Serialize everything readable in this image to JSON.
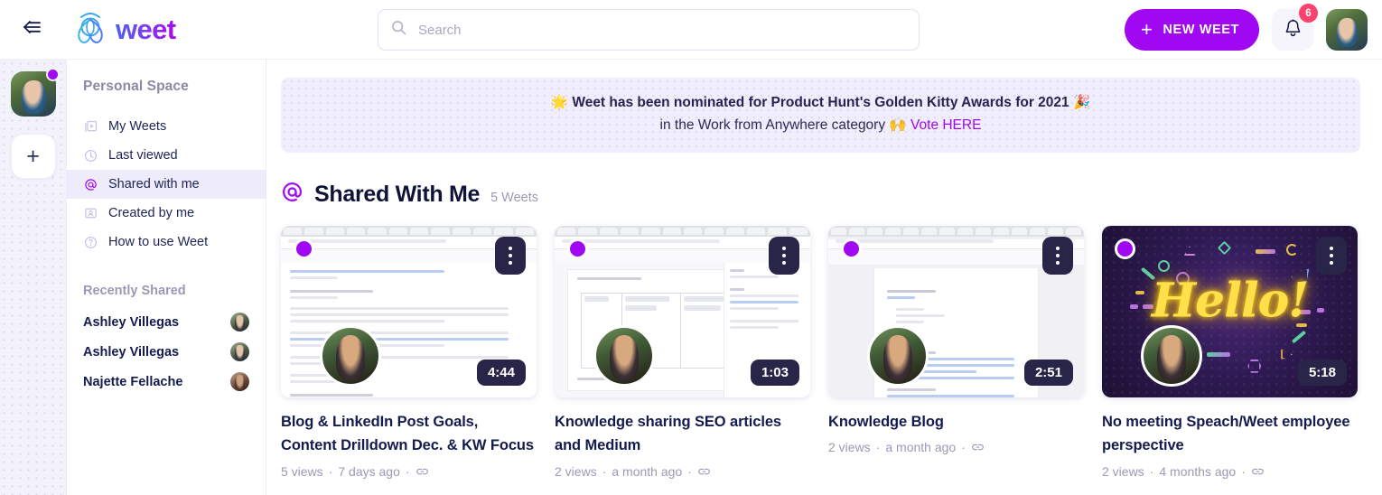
{
  "brand": {
    "name": "weet",
    "logo_icon": "weet-logo-icon",
    "collapse_icon": "collapse-sidebar-icon"
  },
  "header": {
    "search": {
      "placeholder": "Search",
      "value": "",
      "icon": "search-icon"
    },
    "new_weet_label": "NEW WEET",
    "new_weet_icon": "plus-icon",
    "notifications": {
      "icon": "bell-icon",
      "count": "6"
    },
    "avatar": "user-avatar"
  },
  "rail": {
    "workspace_avatar": "workspace-avatar",
    "status_dot": "online-status-dot",
    "add_label": "+",
    "add_icon": "plus-icon"
  },
  "sidebar": {
    "space_title": "Personal Space",
    "items": [
      {
        "label": "My Weets",
        "icon": "video-library-icon",
        "active": false
      },
      {
        "label": "Last viewed",
        "icon": "clock-icon",
        "active": false
      },
      {
        "label": "Shared with me",
        "icon": "at-sign-icon",
        "active": true
      },
      {
        "label": "Created by me",
        "icon": "id-card-icon",
        "active": false
      },
      {
        "label": "How to use Weet",
        "icon": "question-circle-icon",
        "active": false
      }
    ],
    "recently_shared_title": "Recently Shared",
    "recently_shared": [
      {
        "name": "Ashley Villegas",
        "avatar": "contact-avatar"
      },
      {
        "name": "Ashley Villegas",
        "avatar": "contact-avatar"
      },
      {
        "name": "Najette Fellache",
        "avatar": "contact-avatar"
      }
    ]
  },
  "banner": {
    "line1_emoji_left": "🌟",
    "line1": "Weet has been nominated for Product Hunt's Golden Kitty Awards for 2021",
    "line1_emoji_right": "🎉",
    "line2": "in the Work from Anywhere category",
    "line2_emoji": "🙌",
    "link": "Vote HERE",
    "link_color": "#9f08f0"
  },
  "section": {
    "icon": "at-sign-icon",
    "title": "Shared With Me",
    "count": "5 Weets"
  },
  "cards": [
    {
      "title": "Blog & LinkedIn Post Goals, Content Drilldown Dec. & KW Focus",
      "views": "5 views",
      "time": "7 days ago",
      "duration": "4:44",
      "thumb_kind": "gmail-thread",
      "link_icon": "link-icon",
      "menu_icon": "kebab-menu-icon"
    },
    {
      "title": "Knowledge sharing SEO articles and Medium",
      "views": "2 views",
      "time": "a month ago",
      "duration": "1:03",
      "thumb_kind": "google-doc-table",
      "link_icon": "link-icon",
      "menu_icon": "kebab-menu-icon"
    },
    {
      "title": "Knowledge Blog",
      "views": "2 views",
      "time": "a month ago",
      "duration": "2:51",
      "thumb_kind": "google-doc-links",
      "link_icon": "link-icon",
      "menu_icon": "kebab-menu-icon"
    },
    {
      "title": "No meeting Speach/Weet employee perspective",
      "views": "2 views",
      "time": "4 months ago",
      "duration": "5:18",
      "thumb_kind": "hello-neon",
      "hello_text": "Hello!",
      "link_icon": "link-icon",
      "menu_icon": "kebab-menu-icon"
    }
  ],
  "colors": {
    "accent_purple": "#9f08f0",
    "brand_blue": "#4e5ef0",
    "badge_red": "#f9426e",
    "active_nav_bg": "#eeecfa",
    "banner_bg": "#f0edfc",
    "text_dark": "#141b4d",
    "text_muted": "#9b99b5"
  }
}
